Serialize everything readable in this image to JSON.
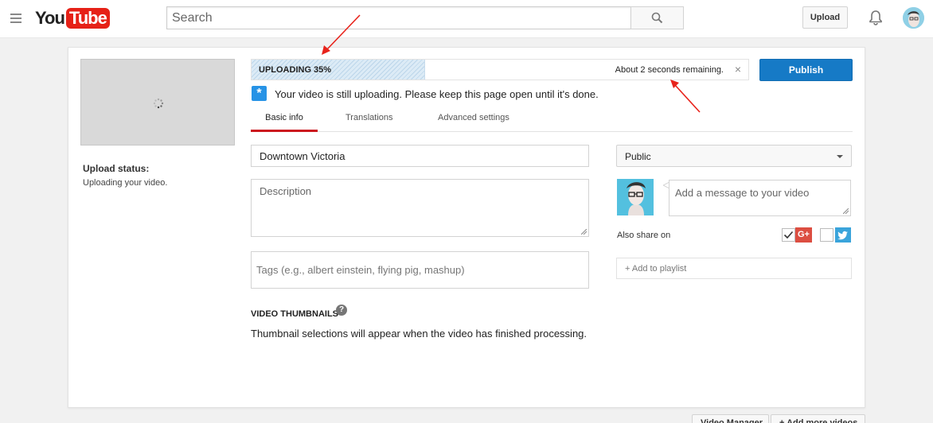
{
  "header": {
    "logo_you": "You",
    "logo_tube": "Tube",
    "search_placeholder": "Search",
    "upload_label": "Upload"
  },
  "upload_panel": {
    "status_label": "Upload status:",
    "status_text": "Uploading your video.",
    "progress_label": "UPLOADING 35%",
    "progress_fraction": 0.35,
    "time_remaining": "About 2 seconds remaining.",
    "close_glyph": "×",
    "publish_label": "Publish",
    "notice": "Your video is still uploading. Please keep this page open until it's done."
  },
  "tabs": [
    {
      "label": "Basic info",
      "active": true
    },
    {
      "label": "Translations",
      "active": false
    },
    {
      "label": "Advanced settings",
      "active": false
    }
  ],
  "form": {
    "title_value": "Downtown Victoria",
    "description_placeholder": "Description",
    "tags_placeholder": "Tags (e.g., albert einstein, flying pig, mashup)",
    "thumbnails_heading": "VIDEO THUMBNAILS",
    "help_glyph": "?",
    "thumbnails_note": "Thumbnail selections will appear when the video has finished processing."
  },
  "sharing": {
    "privacy_value": "Public",
    "message_placeholder": "Add a message to your video",
    "also_share_label": "Also share on",
    "google_plus_label": "G+",
    "google_plus_checked": true,
    "twitter_checked": false,
    "add_to_playlist": "+ Add to playlist"
  },
  "colors": {
    "brand_red": "#e62117",
    "publish_blue": "#167ac6",
    "annotation_red": "#e8231b",
    "google_plus": "#dc4e41",
    "twitter": "#3aa4db"
  },
  "icons": [
    "menu-icon",
    "search-icon",
    "bell-icon",
    "loading-spinner-icon",
    "star-icon",
    "help-icon",
    "google-plus-icon",
    "twitter-icon",
    "chevron-down-icon"
  ],
  "bottom_buttons": [
    {
      "label": "Video Manager"
    },
    {
      "label": "+ Add more videos"
    }
  ]
}
